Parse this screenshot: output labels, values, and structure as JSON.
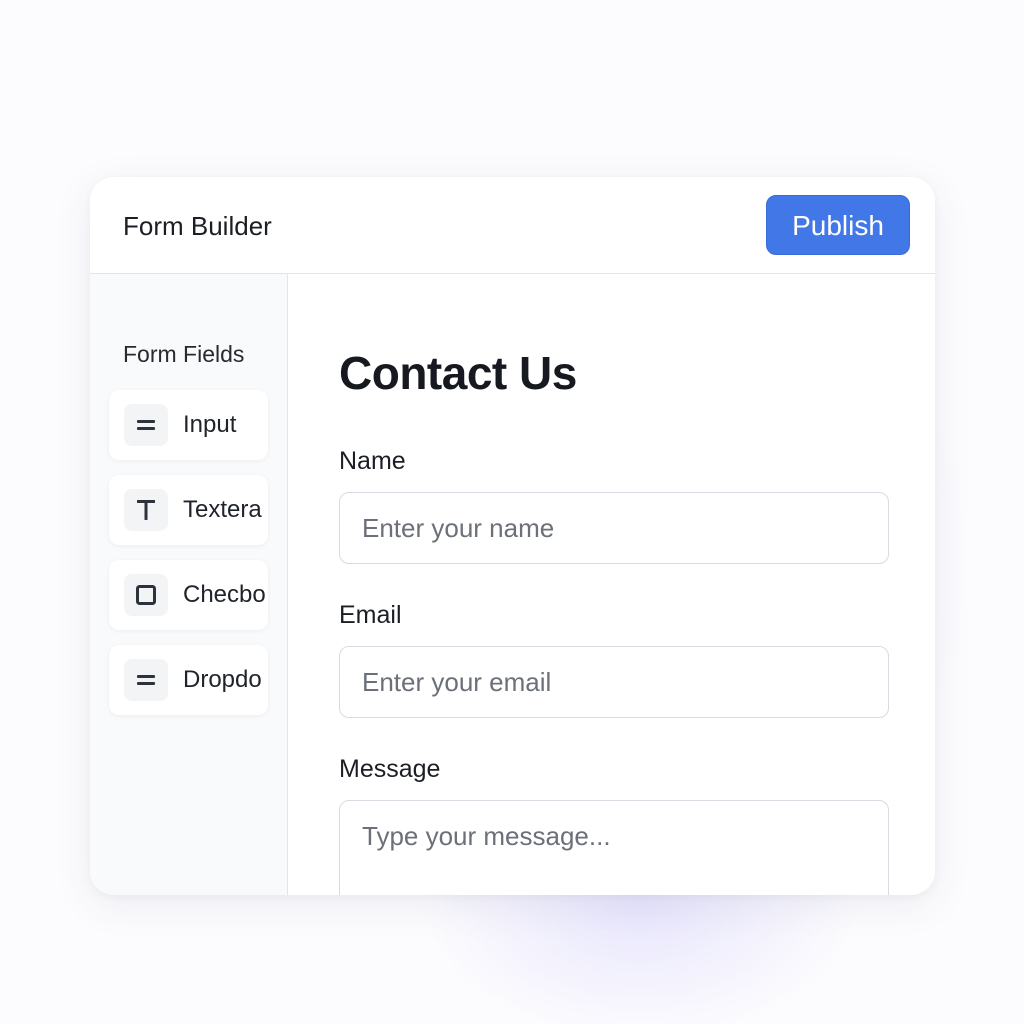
{
  "header": {
    "title": "Form Builder",
    "publish_label": "Publish"
  },
  "sidebar": {
    "title": "Form Fields",
    "items": [
      {
        "label": "Input",
        "icon": "equals-icon"
      },
      {
        "label": "Textera",
        "icon": "text-t-icon"
      },
      {
        "label": "Checbo",
        "icon": "checkbox-icon"
      },
      {
        "label": "Dropdo",
        "icon": "equals-icon"
      }
    ]
  },
  "form": {
    "title": "Contact Us",
    "fields": [
      {
        "label": "Name",
        "placeholder": "Enter your name"
      },
      {
        "label": "Email",
        "placeholder": "Enter your email"
      },
      {
        "label": "Message",
        "placeholder": "Type your message..."
      }
    ]
  },
  "colors": {
    "accent": "#4277e8",
    "sidebar_bg": "#f9fafb",
    "border": "#e3e5ea"
  }
}
